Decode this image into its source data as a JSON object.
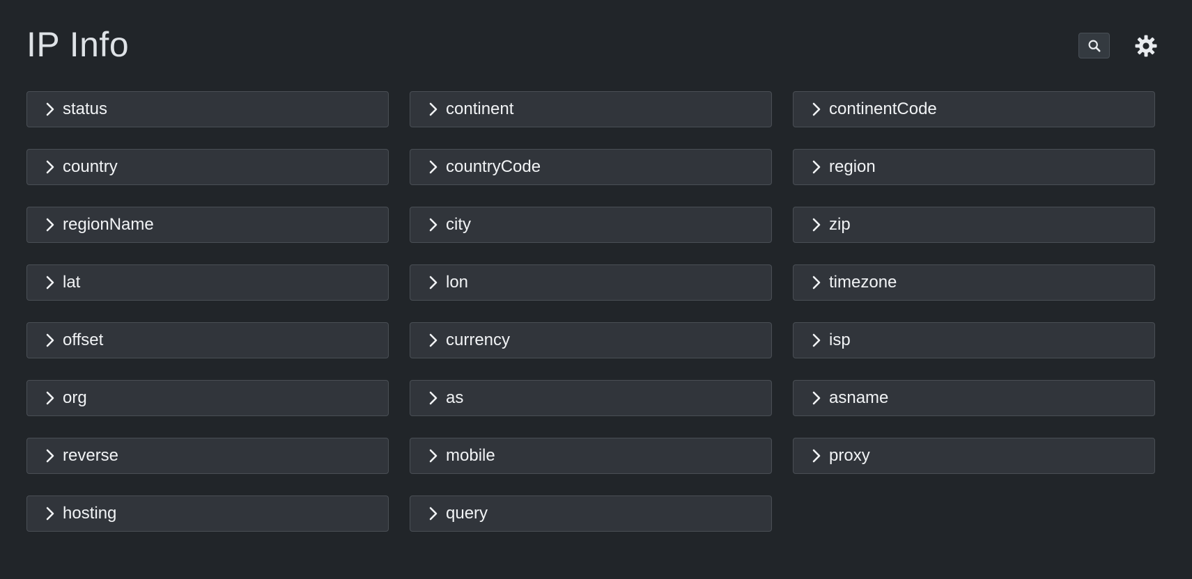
{
  "header": {
    "title": "IP Info",
    "search_icon": "search-icon",
    "theme_icon": "sun-icon"
  },
  "colors": {
    "background": "#212529",
    "item_background": "#31353b",
    "item_border": "#4a4f55",
    "text": "#f1f3f5"
  },
  "fields": [
    {
      "label": "status",
      "icon": "chevron-right-icon"
    },
    {
      "label": "continent",
      "icon": "chevron-right-icon"
    },
    {
      "label": "continentCode",
      "icon": "chevron-right-icon"
    },
    {
      "label": "country",
      "icon": "chevron-right-icon"
    },
    {
      "label": "countryCode",
      "icon": "chevron-right-icon"
    },
    {
      "label": "region",
      "icon": "chevron-right-icon"
    },
    {
      "label": "regionName",
      "icon": "chevron-right-icon"
    },
    {
      "label": "city",
      "icon": "chevron-right-icon"
    },
    {
      "label": "zip",
      "icon": "chevron-right-icon"
    },
    {
      "label": "lat",
      "icon": "chevron-right-icon"
    },
    {
      "label": "lon",
      "icon": "chevron-right-icon"
    },
    {
      "label": "timezone",
      "icon": "chevron-right-icon"
    },
    {
      "label": "offset",
      "icon": "chevron-right-icon"
    },
    {
      "label": "currency",
      "icon": "chevron-right-icon"
    },
    {
      "label": "isp",
      "icon": "chevron-right-icon"
    },
    {
      "label": "org",
      "icon": "chevron-right-icon"
    },
    {
      "label": "as",
      "icon": "chevron-right-icon"
    },
    {
      "label": "asname",
      "icon": "chevron-right-icon"
    },
    {
      "label": "reverse",
      "icon": "chevron-right-icon"
    },
    {
      "label": "mobile",
      "icon": "chevron-right-icon"
    },
    {
      "label": "proxy",
      "icon": "chevron-right-icon"
    },
    {
      "label": "hosting",
      "icon": "chevron-right-icon"
    },
    {
      "label": "query",
      "icon": "chevron-right-icon"
    }
  ]
}
